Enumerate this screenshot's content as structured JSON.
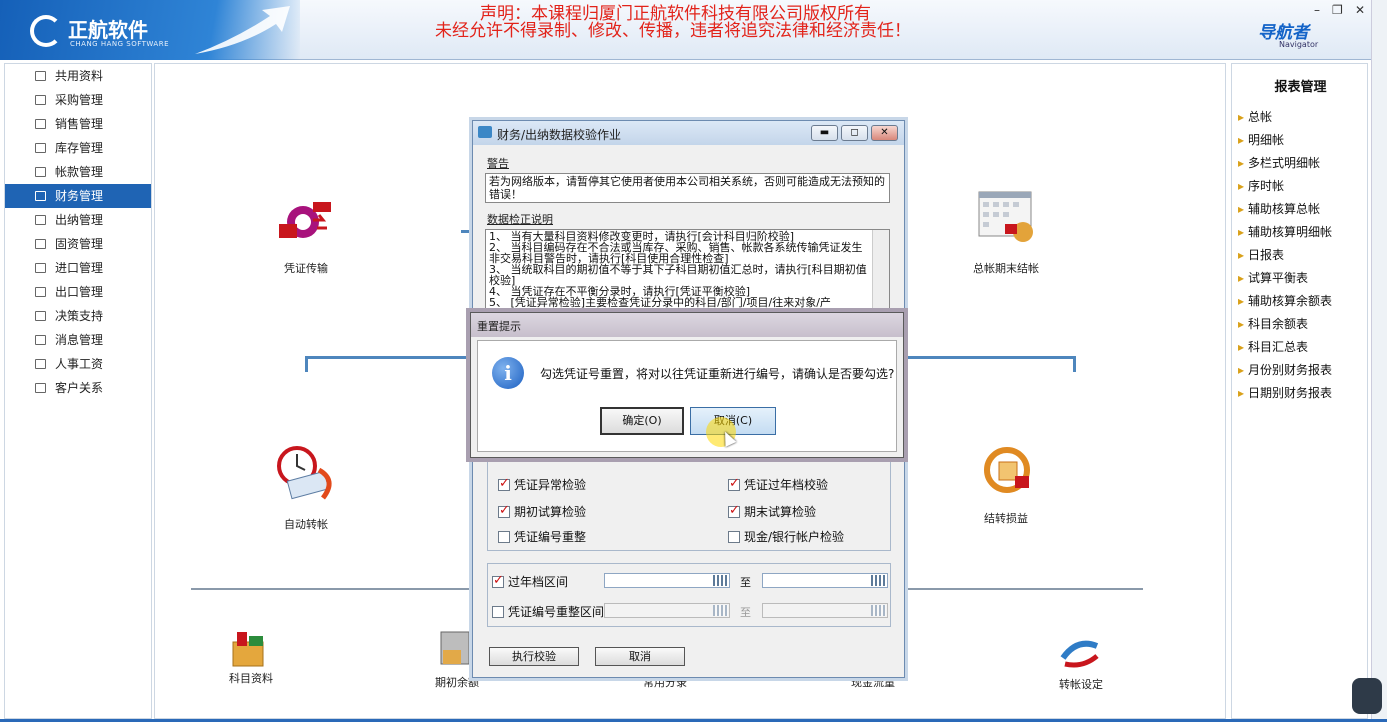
{
  "header": {
    "logo_name": "正航软件",
    "logo_sub": "CHANG HANG SOFTWARE",
    "notice_line1": "声明：本课程归厦门正航软件科技有限公司版权所有",
    "notice_line2": "未经允许不得录制、修改、传播，违者将追究法律和经济责任！",
    "navigator_title": "导航者",
    "navigator_sub": "Navigator",
    "minimize": "–",
    "restore": "❐",
    "close": "✕"
  },
  "left_menu": {
    "items": [
      {
        "label": "共用资料",
        "icon": "list-icon"
      },
      {
        "label": "采购管理",
        "icon": "cart-icon"
      },
      {
        "label": "销售管理",
        "icon": "sales-icon"
      },
      {
        "label": "库存管理",
        "icon": "warehouse-icon"
      },
      {
        "label": "帐款管理",
        "icon": "ledger-icon"
      },
      {
        "label": "财务管理",
        "icon": "finance-icon",
        "active": true
      },
      {
        "label": "出纳管理",
        "icon": "yen-icon"
      },
      {
        "label": "固资管理",
        "icon": "building-icon"
      },
      {
        "label": "进口管理",
        "icon": "import-icon"
      },
      {
        "label": "出口管理",
        "icon": "export-icon"
      },
      {
        "label": "决策支持",
        "icon": "decision-icon"
      },
      {
        "label": "消息管理",
        "icon": "bar-chart-icon"
      },
      {
        "label": "人事工资",
        "icon": "hr-icon"
      },
      {
        "label": "客户关系",
        "icon": "people-icon"
      }
    ]
  },
  "main": {
    "functions": {
      "voucher_transfer": "凭证传输",
      "period_end_close": "总帐期末结帐",
      "auto_transfer": "自动转帐",
      "profit_loss_transfer": "结转损益",
      "subject_data": "科目资料",
      "opening_balance": "期初余额",
      "common_entries": "常用分录",
      "cash_flow": "现金流量",
      "transfer_settings": "转帐设定"
    }
  },
  "right_panel": {
    "title": "报表管理",
    "items": [
      "总帐",
      "明细帐",
      "多栏式明细帐",
      "序时帐",
      "辅助核算总帐",
      "辅助核算明细帐",
      "日报表",
      "试算平衡表",
      "辅助核算余额表",
      "科目余额表",
      "科目汇总表",
      "月份别财务报表",
      "日期别财务报表"
    ]
  },
  "dialog": {
    "title": "财务/出纳数据校验作业",
    "warning_label": "警告",
    "warning_text": "若为网络版本，请暂停其它使用者使用本公司相关系统，否则可能造成无法预知的错误！",
    "desc_label": "数据检正说明",
    "desc_lines": [
      "1、 当有大量科目资料修改变更时，请执行[会计科目归阶校验]",
      "2、 当科目编码存在不合法或当库存、采购、销售、帐款各系统传输凭证发生非交易科目警告时，请执行[科目使用合理性检查]",
      "3、 当统取科目的期初值不等于其下子科目期初值汇总时，请执行[科目期初值校验]",
      "4、 当凭证存在不平衡分录时，请执行[凭证平衡校验]",
      "5、 [凭证异常检验]主要检查凭证分录中的科目/部门/项目/往来对象/产"
    ],
    "checks": {
      "voucher_abnormal": {
        "label": "凭证异常检验",
        "checked": true
      },
      "voucher_overyear": {
        "label": "凭证过年档校验",
        "checked": true
      },
      "opening_trial": {
        "label": "期初试算检验",
        "checked": true
      },
      "closing_trial": {
        "label": "期末试算检验",
        "checked": true
      },
      "voucher_renumber": {
        "label": "凭证编号重整",
        "checked": false
      },
      "cash_bank_check": {
        "label": "现金/银行帐户检验",
        "checked": false
      }
    },
    "range": {
      "overyear_label": "过年档区间",
      "overyear_checked": true,
      "renumber_label": "凭证编号重整区间",
      "renumber_checked": false,
      "to_label": "至"
    },
    "execute_button": "执行校验",
    "cancel_button": "取消"
  },
  "modal": {
    "title": "重置提示",
    "message": "勾选凭证号重置，将对以往凭证重新进行编号，请确认是否要勾选?",
    "ok_button": "确定(O)",
    "cancel_button": "取消(C)",
    "icon": "info-icon"
  },
  "colors": {
    "accent": "#1f64b4",
    "notice_red": "#e2231a",
    "checkmark_red": "#c11111"
  }
}
